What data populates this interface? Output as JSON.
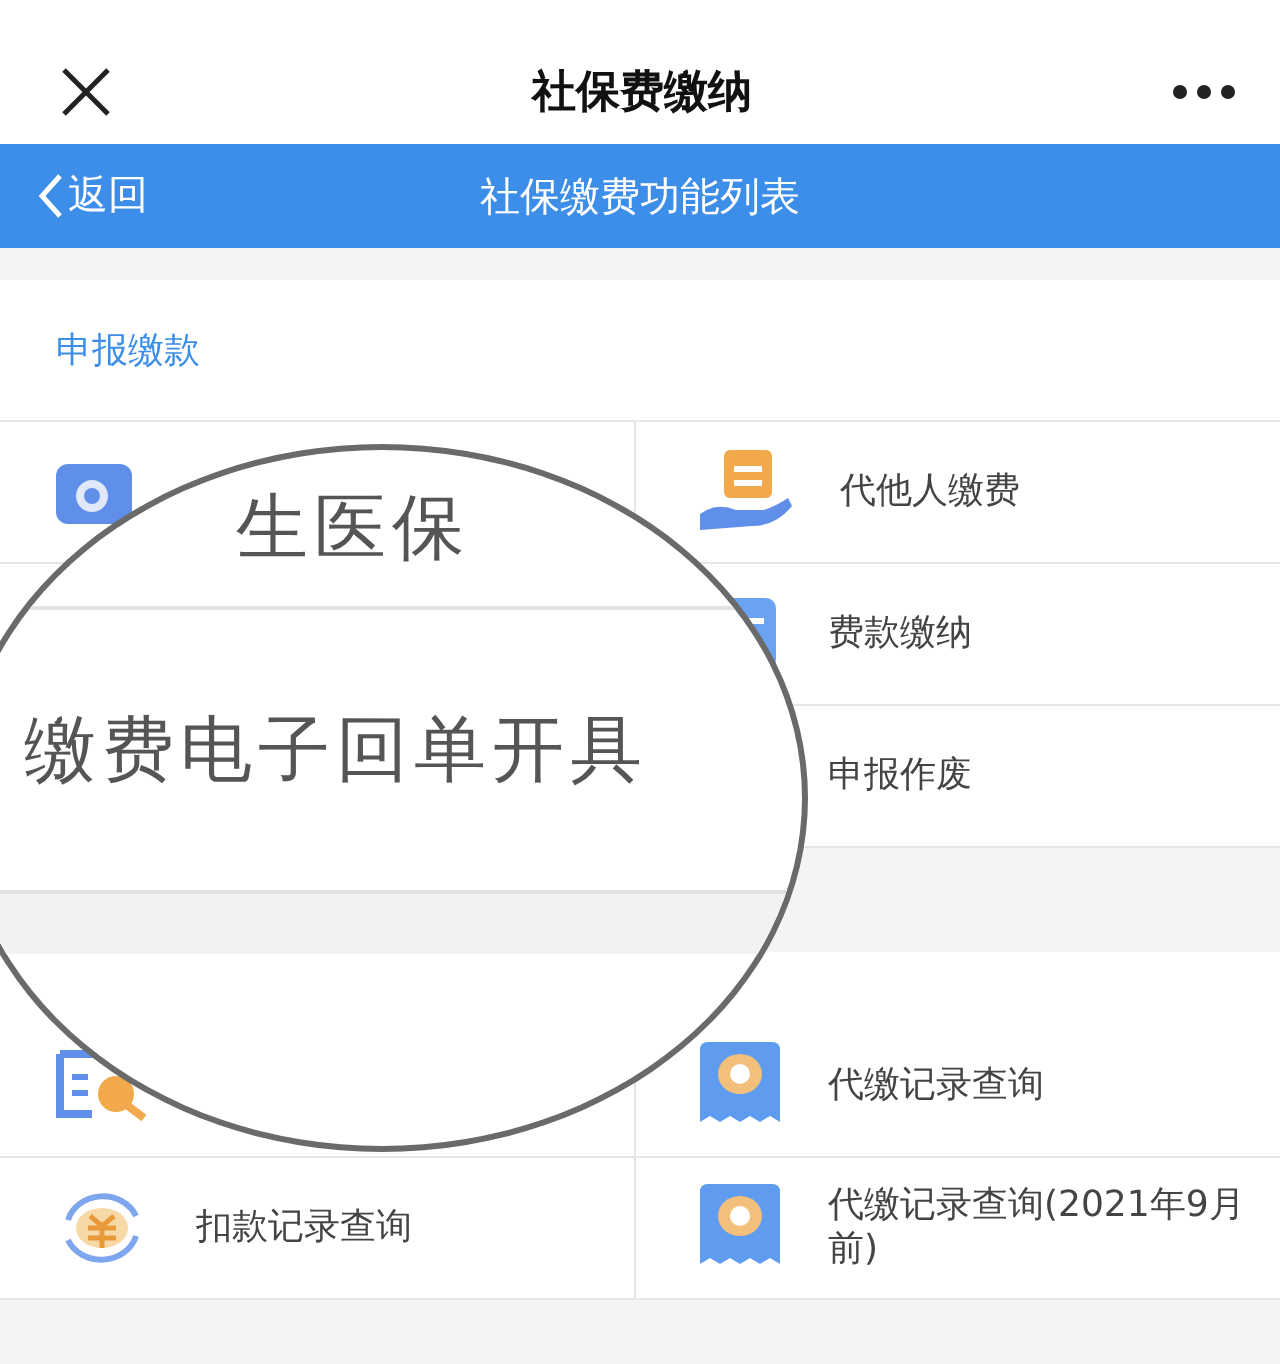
{
  "top_bar": {
    "title": "社保费缴纳"
  },
  "nav_bar": {
    "back": "返回",
    "title": "社保缴费功能列表"
  },
  "sections": [
    {
      "header": "申报缴款",
      "rows": [
        {
          "cells": [
            {
              "kind": "wallet"
            },
            {
              "kind": "hand",
              "label": "代他人缴费"
            }
          ]
        },
        {
          "cells": [
            {
              "kind": "blank"
            },
            {
              "kind": "form",
              "label": "费款缴纳"
            }
          ]
        },
        {
          "cells": [
            {
              "kind": "blank"
            },
            {
              "kind": "blank",
              "label": "申报作废"
            }
          ]
        }
      ]
    },
    {
      "rows": [
        {
          "cells": [
            {
              "kind": "search"
            },
            {
              "kind": "receipt",
              "label": "代缴记录查询"
            }
          ]
        },
        {
          "cells": [
            {
              "kind": "yuan",
              "label": "扣款记录查询"
            },
            {
              "kind": "receipt",
              "label": "代缴记录查询(2021年9月前)"
            }
          ]
        }
      ]
    }
  ],
  "magnifier": {
    "lines": [
      "生医保",
      "缴费电子回单开具"
    ]
  }
}
